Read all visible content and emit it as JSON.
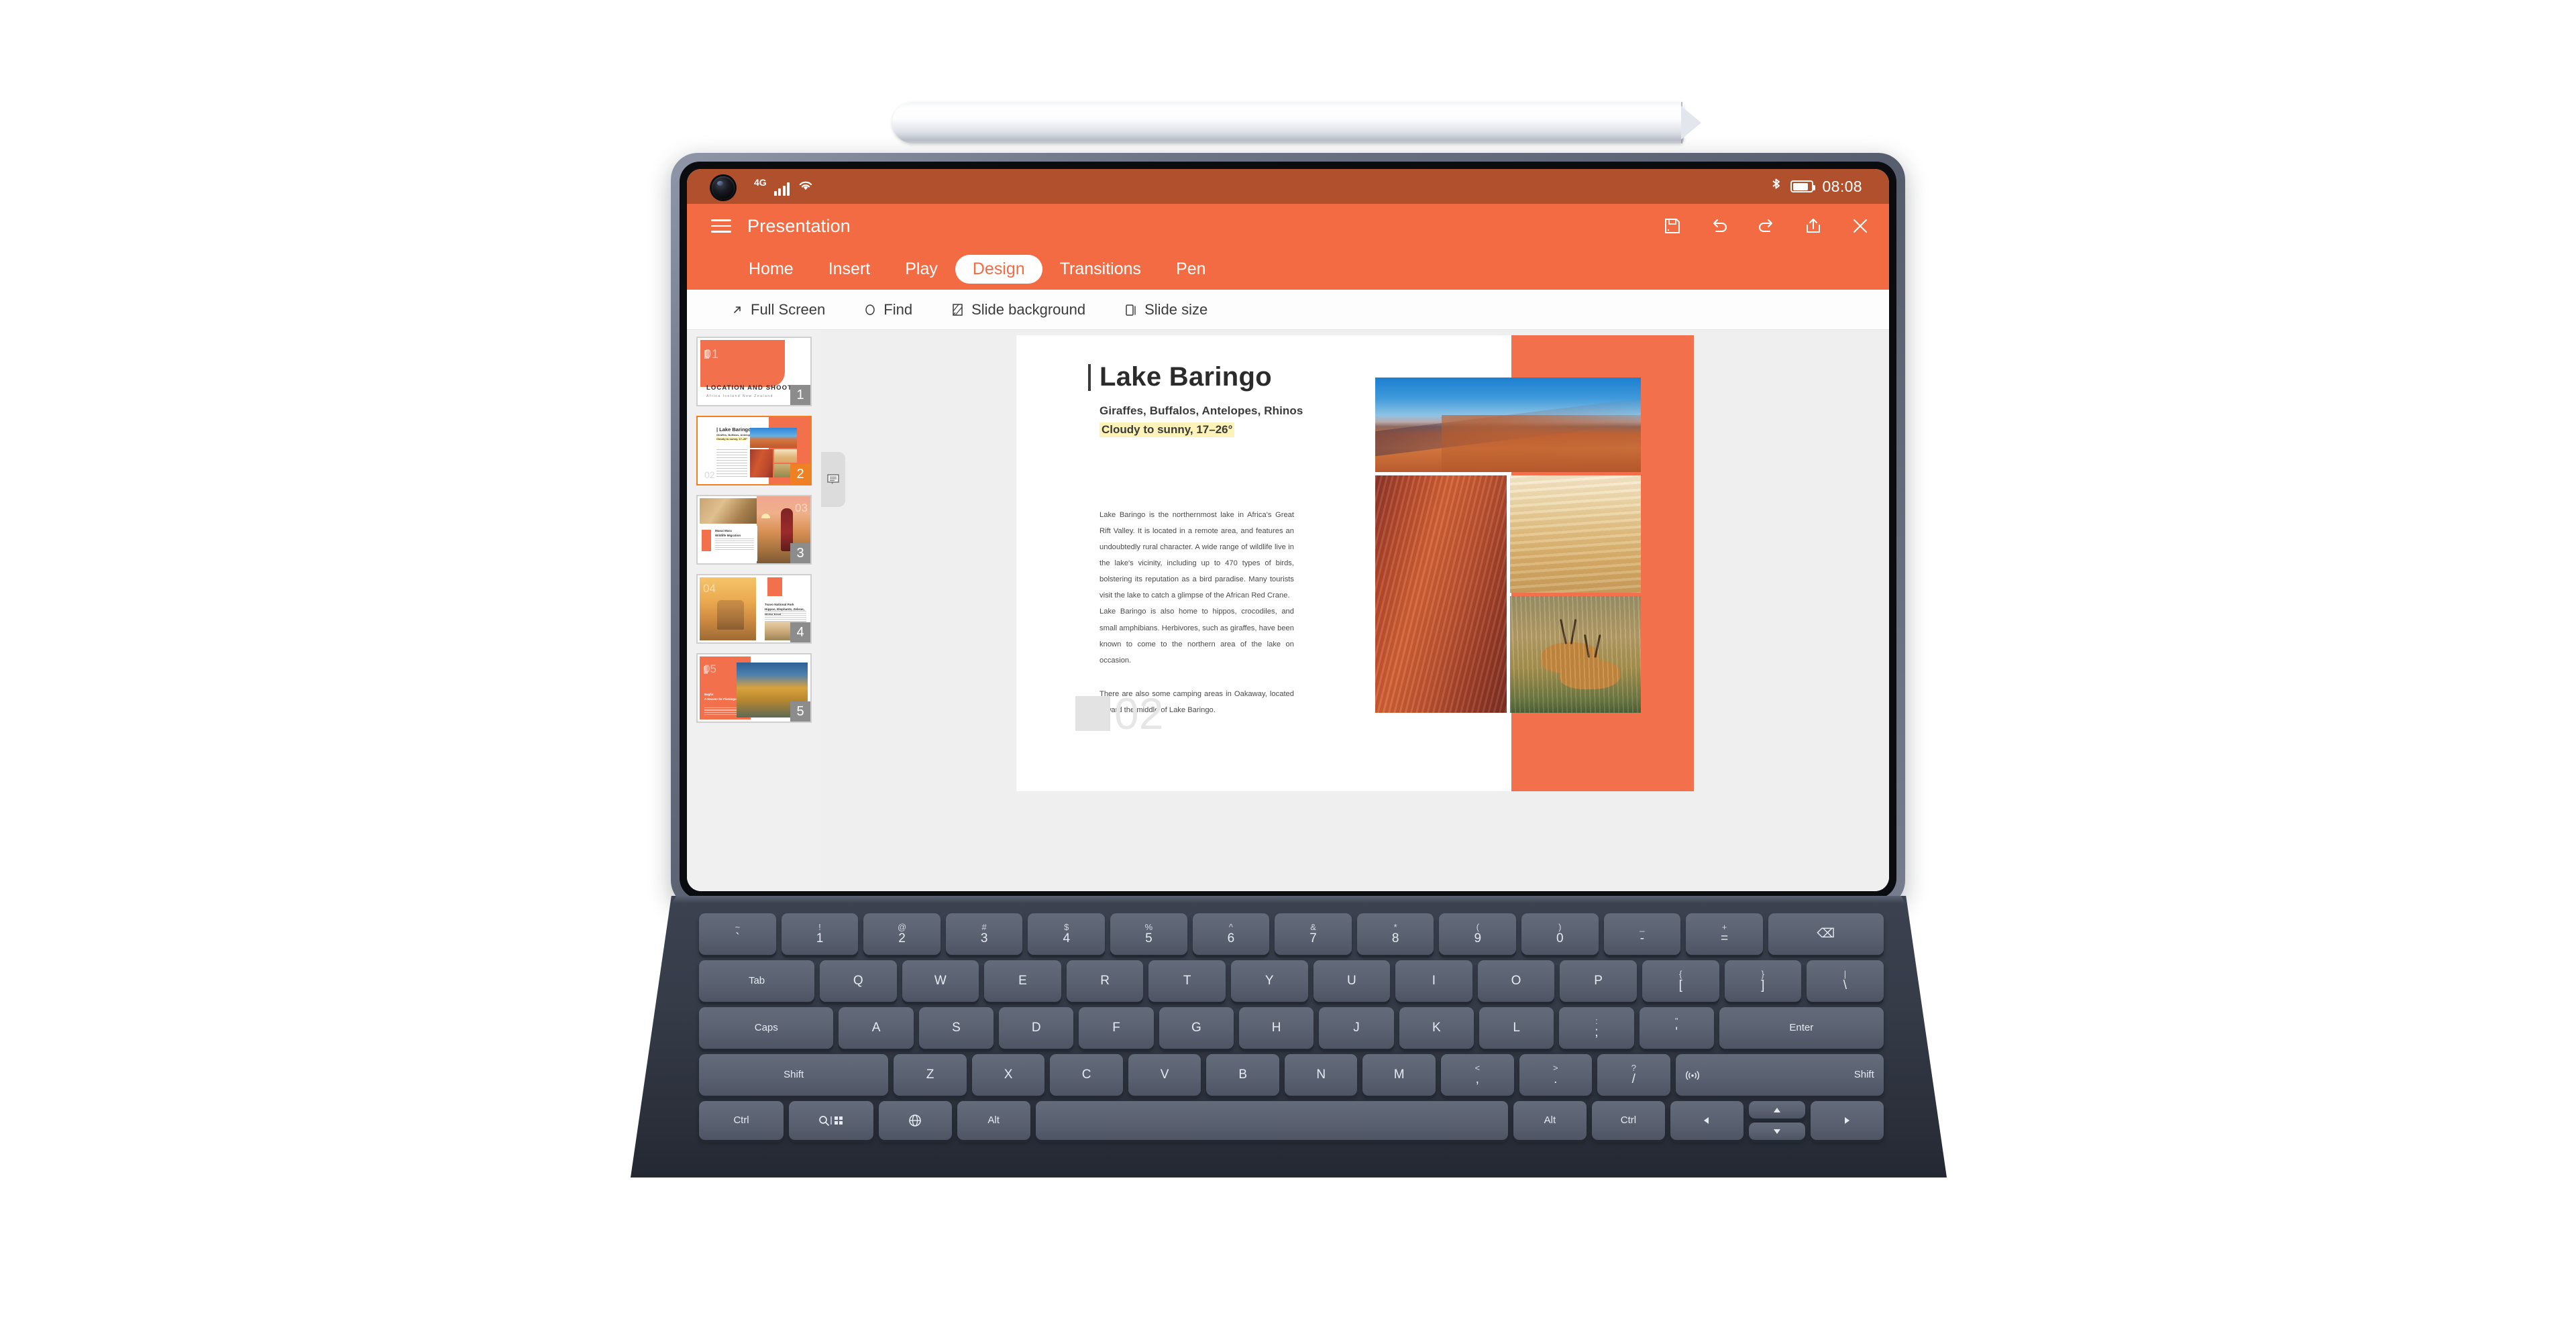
{
  "device": {
    "type": "tablet-with-keyboard-and-stylus",
    "stylus": "stylus-pen",
    "camera": "front-camera"
  },
  "statusbar": {
    "network_label": "4G",
    "signal_icon": "signal-bars-icon",
    "wifi_icon": "wifi-icon",
    "bluetooth_icon": "bluetooth-icon",
    "battery_icon": "battery-icon",
    "time": "08:08"
  },
  "app": {
    "menu_icon": "hamburger-menu-icon",
    "title": "Presentation",
    "actions": [
      {
        "name": "save-icon",
        "label": "Save"
      },
      {
        "name": "undo-icon",
        "label": "Undo"
      },
      {
        "name": "redo-icon",
        "label": "Redo"
      },
      {
        "name": "share-icon",
        "label": "Share"
      },
      {
        "name": "close-icon",
        "label": "Close"
      }
    ],
    "tabs": [
      {
        "label": "Home",
        "active": false
      },
      {
        "label": "Insert",
        "active": false
      },
      {
        "label": "Play",
        "active": false
      },
      {
        "label": "Design",
        "active": true
      },
      {
        "label": "Transitions",
        "active": false
      },
      {
        "label": "Pen",
        "active": false
      }
    ],
    "active_tab": "Design",
    "accent_color": "#f26b43",
    "statusbar_color": "#b0502d"
  },
  "toolbar": {
    "items": [
      {
        "label": "Full Screen",
        "icon": "fullscreen-arrow-icon"
      },
      {
        "label": "Find",
        "icon": "find-circle-icon"
      },
      {
        "label": "Slide background",
        "icon": "slide-background-icon"
      },
      {
        "label": "Slide size",
        "icon": "slide-size-icon"
      }
    ]
  },
  "notes_tab": {
    "icon": "comment-notes-icon"
  },
  "thumbnails": {
    "selected_index": 2,
    "items": [
      {
        "number": "1",
        "big_number": "01",
        "title": "LOCATION AND SHOOTING LIST",
        "subtitle": "Africa   Iceland   New Zealand",
        "selected": false
      },
      {
        "number": "2",
        "big_number": "02",
        "title": "| Lake Baringo",
        "subtitle": "Giraffes, Buffalos, Antelopes, Rhinos",
        "highlight": "Cloudy to sunny, 17–26°",
        "selected": true
      },
      {
        "number": "3",
        "big_number": "03",
        "title": "Masai Mara",
        "subtitle": "Wildlife Migration",
        "selected": false
      },
      {
        "number": "4",
        "big_number": "04",
        "title": "Tsavo National Park",
        "subtitle": "Hippos, Elephants, Zebras, Water Fowl",
        "selected": false
      },
      {
        "number": "5",
        "big_number": "05",
        "title": "Baglio",
        "subtitle": "A Heaven for Flamingos",
        "selected": false
      }
    ]
  },
  "slide": {
    "number": "02",
    "title": "Lake Baringo",
    "subtitle": "Giraffes, Buffalos, Antelopes, Rhinos",
    "highlight": "Cloudy to sunny, 17–26°",
    "paragraphs": [
      "Lake Baringo is the northernmost lake in Africa's Great Rift Valley. It is located in a remote area, and features an undoubtedly rural character. A wide range of wildlife live in the lake's vicinity, including up to 470 types of birds, bolstering its reputation as a bird paradise. Many tourists visit the lake to catch a glimpse of the African Red Crane.",
      "Lake Baringo is also home to hippos, crocodiles, and small amphibians. Herbivores, such as giraffes, have been known to come to the northern area of the lake on occasion.",
      "There are also some camping areas in Oakaway, located toward the middle of Lake Baringo."
    ],
    "images": [
      {
        "name": "desert-dune-blue-sky-photo"
      },
      {
        "name": "red-sand-texture-photo"
      },
      {
        "name": "pale-desert-caravan-photo"
      },
      {
        "name": "antelopes-running-grassland-photo"
      }
    ]
  },
  "keyboard": {
    "rows": [
      [
        {
          "sup": "~",
          "main": "`"
        },
        {
          "sup": "!",
          "main": "1"
        },
        {
          "sup": "@",
          "main": "2"
        },
        {
          "sup": "#",
          "main": "3"
        },
        {
          "sup": "$",
          "main": "4"
        },
        {
          "sup": "%",
          "main": "5"
        },
        {
          "sup": "^",
          "main": "6"
        },
        {
          "sup": "&",
          "main": "7"
        },
        {
          "sup": "*",
          "main": "8"
        },
        {
          "sup": "(",
          "main": "9"
        },
        {
          "sup": ")",
          "main": "0"
        },
        {
          "sup": "_",
          "main": "-"
        },
        {
          "sup": "+",
          "main": "="
        },
        {
          "main": "⌫",
          "width": "w15"
        }
      ],
      [
        {
          "main": "Tab",
          "width": "w15",
          "small": true
        },
        {
          "main": "Q"
        },
        {
          "main": "W"
        },
        {
          "main": "E"
        },
        {
          "main": "R"
        },
        {
          "main": "T"
        },
        {
          "main": "Y"
        },
        {
          "main": "U"
        },
        {
          "main": "I"
        },
        {
          "main": "O"
        },
        {
          "main": "P"
        },
        {
          "sup": "{",
          "main": "["
        },
        {
          "sup": "}",
          "main": "]"
        },
        {
          "sup": "|",
          "main": "\\"
        }
      ],
      [
        {
          "main": "Caps",
          "width": "w18",
          "small": true
        },
        {
          "main": "A"
        },
        {
          "main": "S"
        },
        {
          "main": "D"
        },
        {
          "main": "F"
        },
        {
          "main": "G"
        },
        {
          "main": "H"
        },
        {
          "main": "J"
        },
        {
          "main": "K"
        },
        {
          "main": "L"
        },
        {
          "sup": ":",
          "main": ";"
        },
        {
          "sup": "\"",
          "main": "'"
        },
        {
          "main": "Enter",
          "width": "w22",
          "small": true
        }
      ],
      [
        {
          "main": "Shift",
          "width": "w26",
          "small": true
        },
        {
          "main": "Z"
        },
        {
          "main": "X"
        },
        {
          "main": "C"
        },
        {
          "main": "V"
        },
        {
          "main": "B"
        },
        {
          "main": "N"
        },
        {
          "main": "M"
        },
        {
          "sup": "<",
          "main": ","
        },
        {
          "sup": ">",
          "main": "."
        },
        {
          "sup": "?",
          "main": "/"
        },
        {
          "main": "Shift",
          "width": "w26",
          "small": true,
          "icon": "wifi-cast-icon"
        }
      ],
      [
        {
          "main": "Ctrl",
          "width": "w15",
          "small": true
        },
        {
          "main": "",
          "icon": "search-grid-icon",
          "width": "w15"
        },
        {
          "main": "",
          "icon": "globe-icon",
          "width": "w13"
        },
        {
          "main": "Alt",
          "width": "w13",
          "small": true
        },
        {
          "main": "",
          "width": "space"
        },
        {
          "main": "Alt",
          "width": "w13",
          "small": true
        },
        {
          "main": "Ctrl",
          "width": "w13",
          "small": true
        },
        {
          "main": "◀",
          "width": "w13"
        },
        {
          "main": "▲▼",
          "width": "w13",
          "split": true
        },
        {
          "main": "▶",
          "width": "w13"
        }
      ]
    ]
  }
}
